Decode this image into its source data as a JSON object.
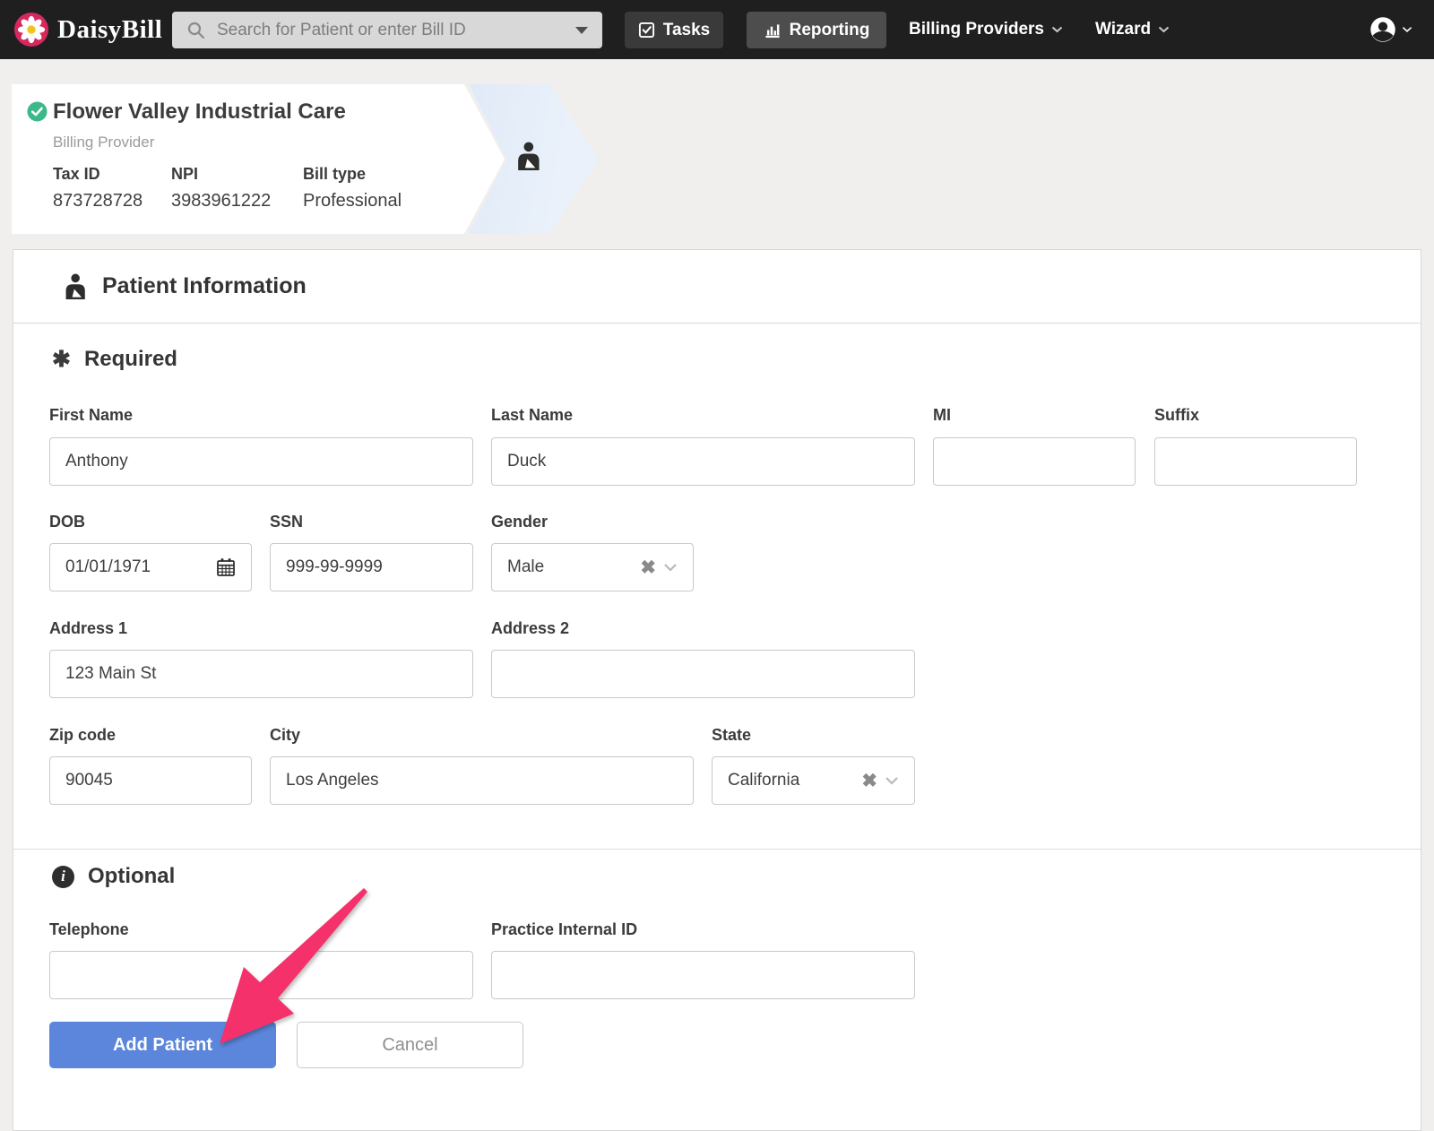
{
  "navbar": {
    "brand": "DaisyBill",
    "search_placeholder": "Search for Patient or enter Bill ID",
    "tasks_label": "Tasks",
    "reporting_label": "Reporting",
    "billing_providers_label": "Billing Providers",
    "wizard_label": "Wizard"
  },
  "billing_provider": {
    "name": "Flower Valley Industrial Care",
    "subtitle": "Billing Provider",
    "fields": [
      {
        "label": "Tax ID",
        "value": "873728728"
      },
      {
        "label": "NPI",
        "value": "3983961222"
      },
      {
        "label": "Bill type",
        "value": "Professional"
      }
    ]
  },
  "patient_form": {
    "title": "Patient Information",
    "required_heading": "Required",
    "optional_heading": "Optional",
    "fields": {
      "first_name": {
        "label": "First Name",
        "value": "Anthony"
      },
      "last_name": {
        "label": "Last Name",
        "value": "Duck"
      },
      "mi": {
        "label": "MI",
        "value": ""
      },
      "suffix": {
        "label": "Suffix",
        "value": ""
      },
      "dob": {
        "label": "DOB",
        "value": "01/01/1971"
      },
      "ssn": {
        "label": "SSN",
        "value": "999-99-9999"
      },
      "gender": {
        "label": "Gender",
        "value": "Male"
      },
      "address1": {
        "label": "Address 1",
        "value": "123 Main St"
      },
      "address2": {
        "label": "Address 2",
        "value": ""
      },
      "zip": {
        "label": "Zip code",
        "value": "90045"
      },
      "city": {
        "label": "City",
        "value": "Los Angeles"
      },
      "state": {
        "label": "State",
        "value": "California"
      },
      "telephone": {
        "label": "Telephone",
        "value": ""
      },
      "practice_internal_id": {
        "label": "Practice Internal ID",
        "value": ""
      }
    },
    "buttons": {
      "add_patient": "Add Patient",
      "cancel": "Cancel"
    }
  },
  "icons": {
    "required_asterisk": "✱",
    "info_glyph": "i",
    "clear_glyph": "✖"
  },
  "colors": {
    "navbar_bg": "#1f1f1f",
    "accent_blue": "#5b86db",
    "annotation_pink": "#f4316b",
    "success_green": "#3cb98b",
    "logo_pink": "#d6285f",
    "logo_yellow": "#f0c419",
    "chevron_band_blue": "#e4edf9"
  }
}
